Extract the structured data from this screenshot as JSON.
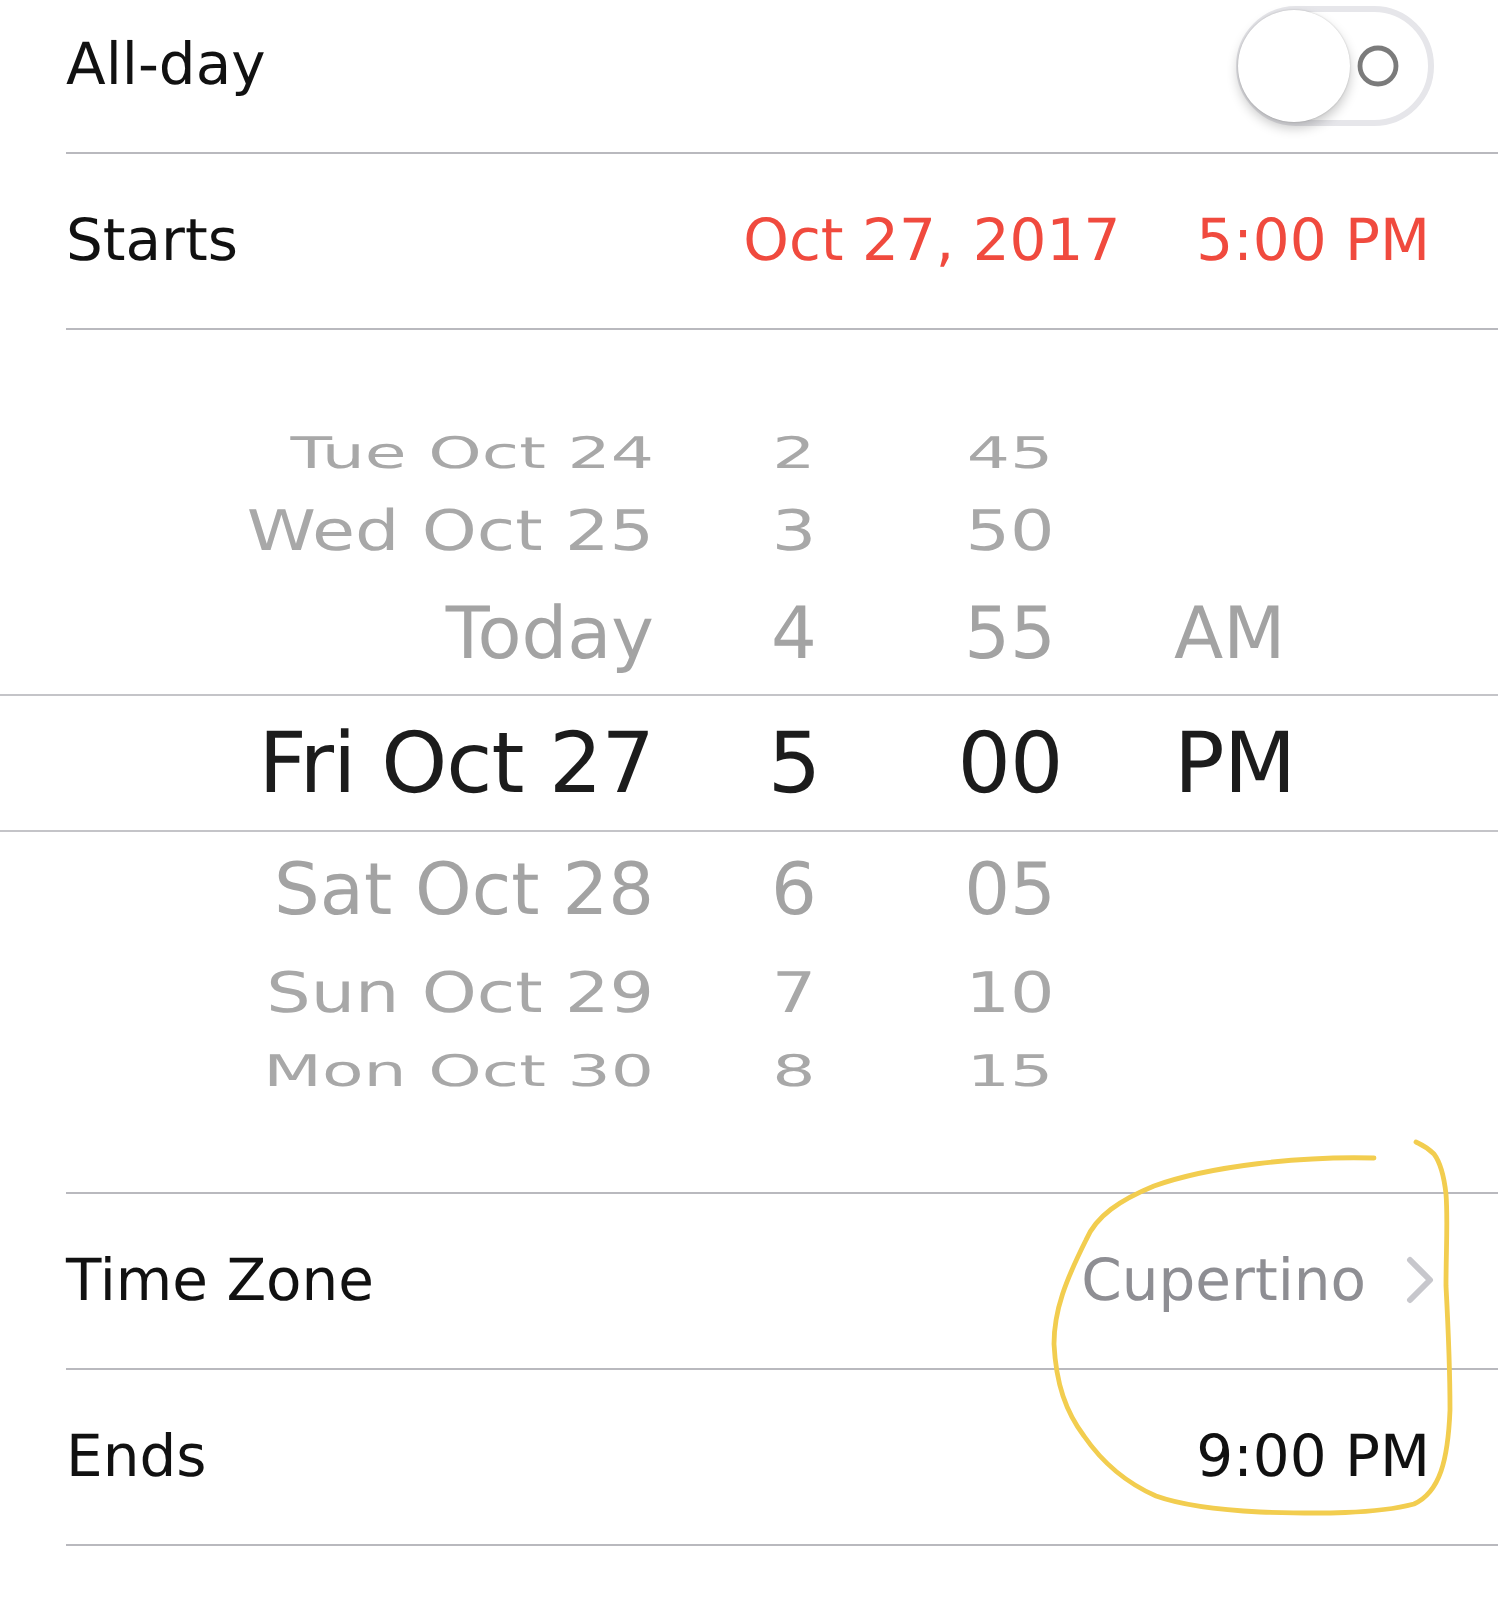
{
  "all_day": {
    "label": "All-day",
    "on": false
  },
  "starts": {
    "label": "Starts",
    "date": "Oct 27, 2017",
    "time": "5:00 PM",
    "expanded": true
  },
  "picker": {
    "rows": [
      {
        "date": "Tue Oct 24",
        "hour": "2",
        "minute": "45",
        "selected": false
      },
      {
        "date": "Wed Oct 25",
        "hour": "3",
        "minute": "50",
        "selected": false
      },
      {
        "date": "Today",
        "hour": "4",
        "minute": "55",
        "period": "AM",
        "selected": false
      },
      {
        "date": "Fri Oct 27",
        "hour": "5",
        "minute": "00",
        "period": "PM",
        "selected": true
      },
      {
        "date": "Sat Oct 28",
        "hour": "6",
        "minute": "05",
        "selected": false
      },
      {
        "date": "Sun Oct 29",
        "hour": "7",
        "minute": "10",
        "selected": false
      },
      {
        "date": "Mon Oct 30",
        "hour": "8",
        "minute": "15",
        "selected": false
      }
    ]
  },
  "time_zone": {
    "label": "Time Zone",
    "value": "Cupertino"
  },
  "ends": {
    "label": "Ends",
    "time": "9:00 PM",
    "expanded": false
  }
}
